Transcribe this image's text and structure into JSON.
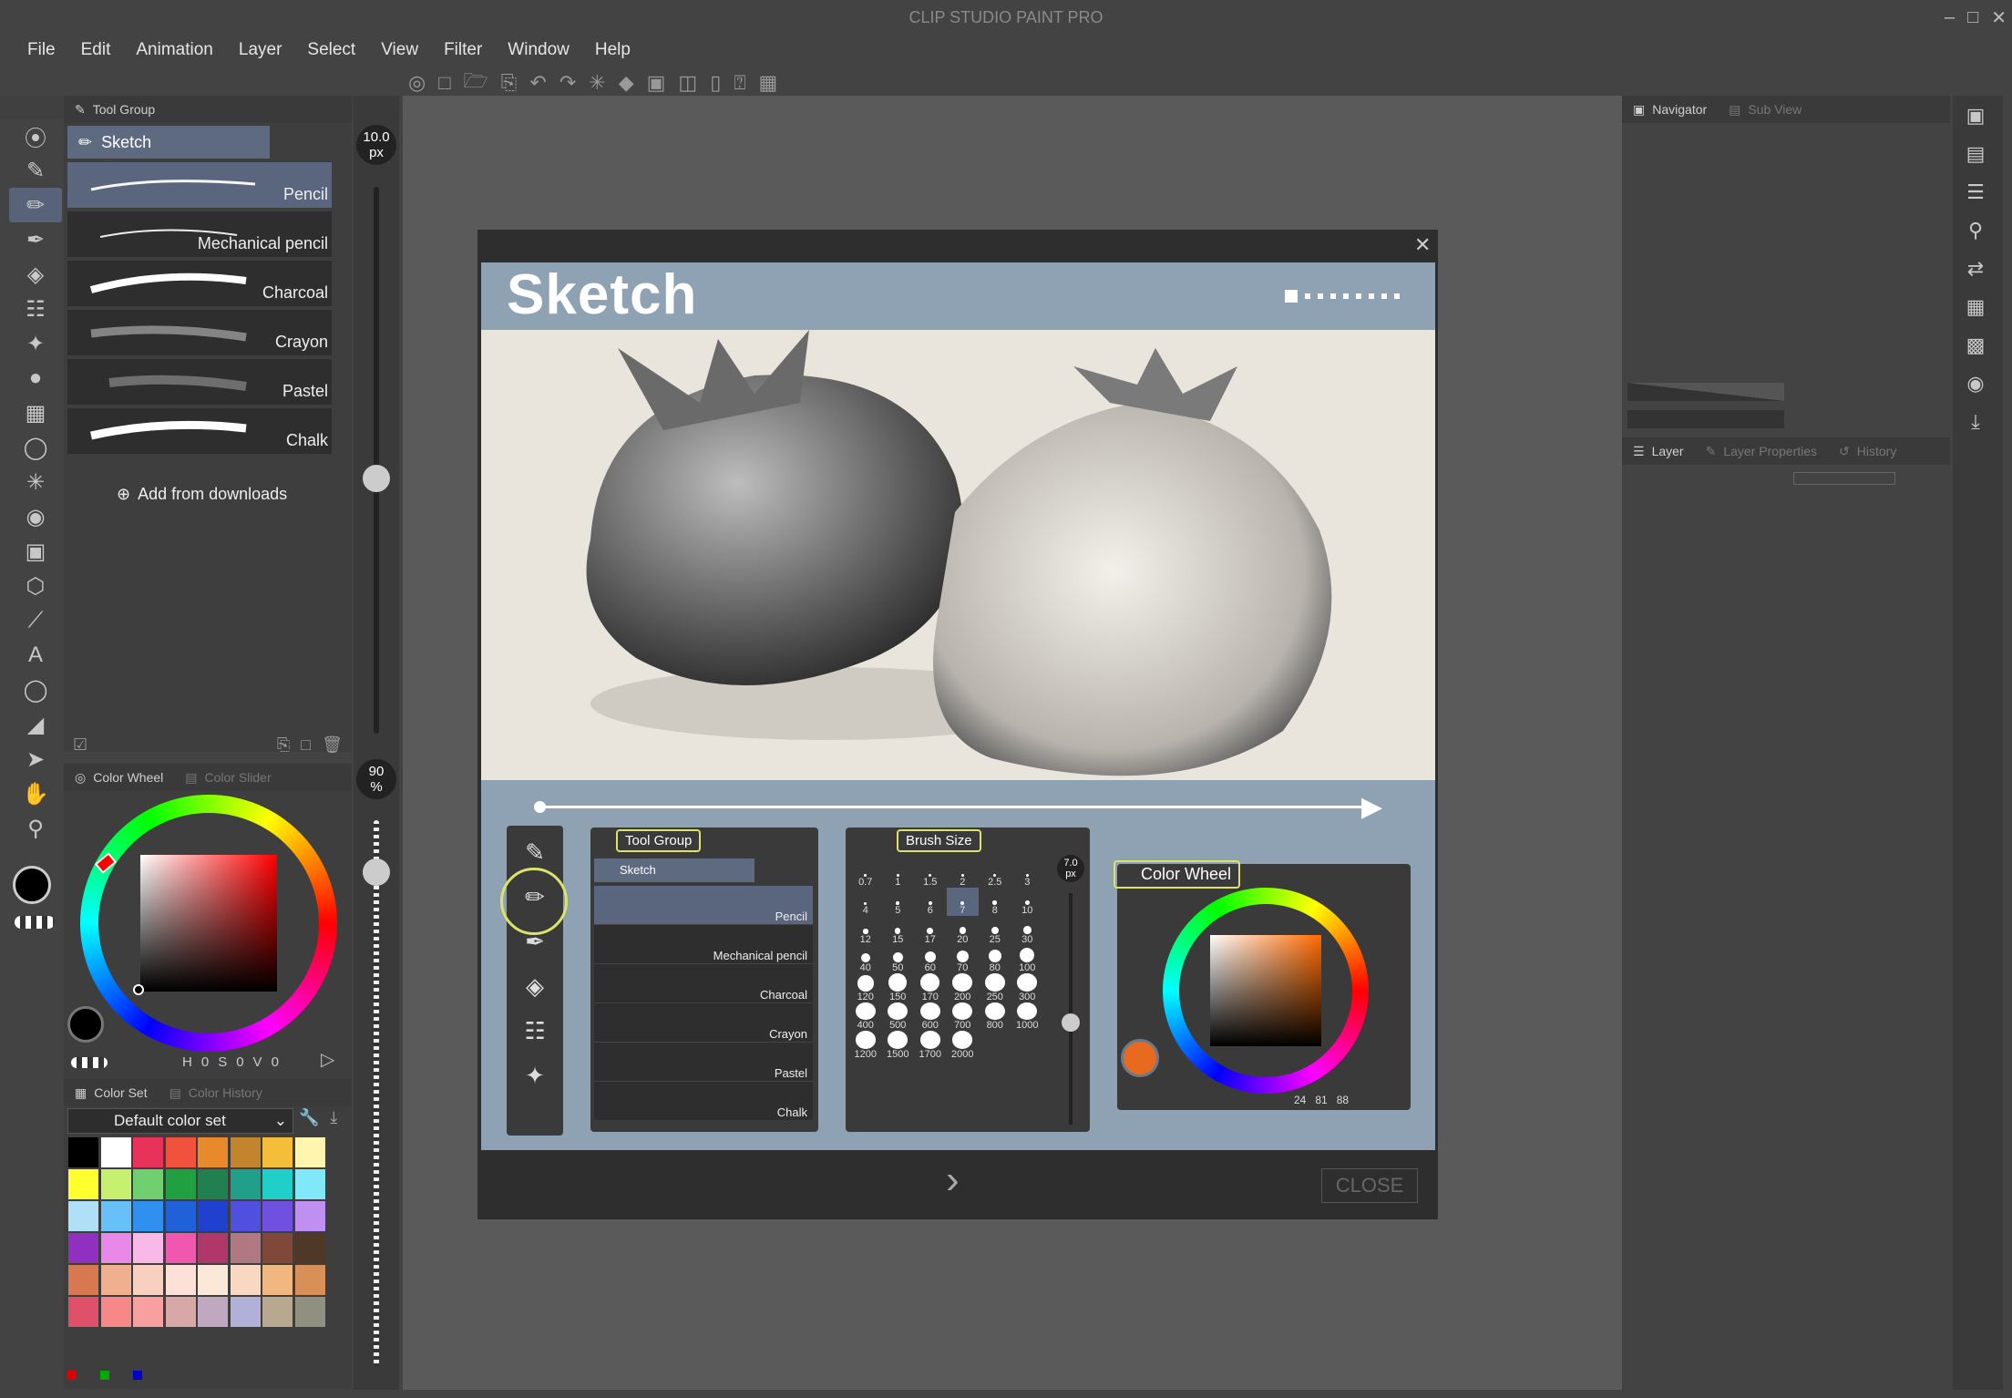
{
  "app": {
    "title": "CLIP STUDIO PAINT PRO"
  },
  "menu": [
    "File",
    "Edit",
    "Animation",
    "Layer",
    "Select",
    "View",
    "Filter",
    "Window",
    "Help"
  ],
  "subtool": {
    "tab": "Tool Group",
    "group": "Sketch",
    "brushes": [
      "Pencil",
      "Mechanical pencil",
      "Charcoal",
      "Crayon",
      "Pastel",
      "Chalk"
    ],
    "add": "Add from downloads"
  },
  "brush_size": {
    "value": "10.0",
    "unit": "px"
  },
  "opacity": {
    "value": "90",
    "unit": "%"
  },
  "color_wheel": {
    "tab": "Color Wheel",
    "tab2": "Color Slider",
    "h_label": "H",
    "h": "0",
    "s_label": "S",
    "s": "0",
    "v_label": "V",
    "v": "0"
  },
  "color_set": {
    "tab": "Color Set",
    "tab2": "Color History",
    "set_name": "Default color set",
    "colors": [
      "#000000",
      "#ffffff",
      "#e8325a",
      "#f0523e",
      "#e88a2c",
      "#c2842c",
      "#f5be3a",
      "#fff4b0",
      "#ffff30",
      "#c8f070",
      "#70d070",
      "#20a040",
      "#208050",
      "#20a08a",
      "#20d0c8",
      "#80e8f8",
      "#b0e0f8",
      "#68c0f8",
      "#3090f0",
      "#2060d8",
      "#2040d0",
      "#5050e0",
      "#7050e0",
      "#c090f0",
      "#9030c0",
      "#e888e8",
      "#f8b8e8",
      "#f058b0",
      "#b03868",
      "#b07880",
      "#804838",
      "#503828",
      "#d87850",
      "#f0b090",
      "#f8d0c0",
      "#fde0d8",
      "#fce8d8",
      "#f8d8c0",
      "#f0b880",
      "#d89058",
      "#e05068",
      "#f88888",
      "#f8a0a0",
      "#d8a8a8",
      "#c0a8c0",
      "#b0b0d8",
      "#b8a890",
      "#909080"
    ]
  },
  "right": {
    "navigator": "Navigator",
    "subview": "Sub View",
    "layer": "Layer",
    "layer_props": "Layer Properties",
    "history": "History"
  },
  "dialog": {
    "title": "Sketch",
    "close": "CLOSE",
    "mini_tool_group": "Tool Group",
    "mini_sketch": "Sketch",
    "mini_brushes": [
      "Pencil",
      "Mechanical pencil",
      "Charcoal",
      "Crayon",
      "Pastel",
      "Chalk"
    ],
    "brush_size": "Brush Size",
    "mini_size_value": "7.0",
    "mini_size_unit": "px",
    "sizes": [
      "0.7",
      "1",
      "1.5",
      "2",
      "2.5",
      "3",
      "4",
      "5",
      "6",
      "7",
      "8",
      "10",
      "12",
      "15",
      "17",
      "20",
      "25",
      "30",
      "40",
      "50",
      "60",
      "70",
      "80",
      "100",
      "120",
      "150",
      "170",
      "200",
      "250",
      "300",
      "400",
      "500",
      "600",
      "700",
      "800",
      "1000",
      "1200",
      "1500",
      "1700",
      "2000"
    ],
    "color_wheel": "Color Wheel",
    "mini_h": "24",
    "mini_s": "81",
    "mini_v": "88"
  }
}
